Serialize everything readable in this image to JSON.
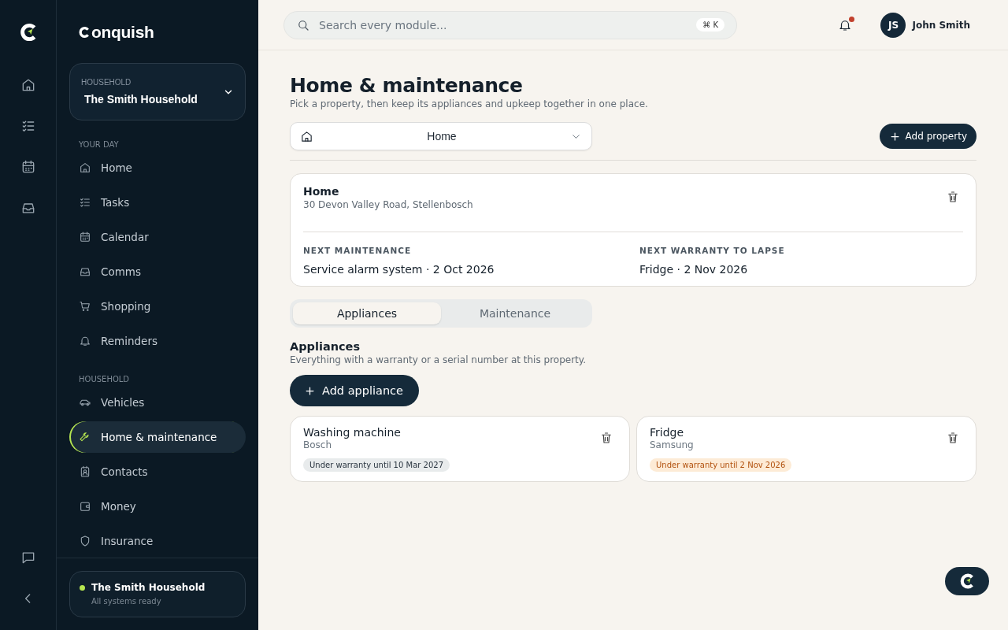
{
  "brand": {
    "wordmark": "onquish"
  },
  "sidebar": {
    "household_picker": {
      "label": "HOUSEHOLD",
      "value": "The Smith Household"
    },
    "sections": [
      {
        "heading": "YOUR DAY",
        "items": [
          {
            "label": "Home",
            "selected": false
          },
          {
            "label": "Tasks",
            "selected": false
          },
          {
            "label": "Calendar",
            "selected": false
          },
          {
            "label": "Comms",
            "selected": false
          },
          {
            "label": "Shopping",
            "selected": false
          },
          {
            "label": "Reminders",
            "selected": false
          }
        ]
      },
      {
        "heading": "HOUSEHOLD",
        "items": [
          {
            "label": "Vehicles",
            "selected": false
          },
          {
            "label": "Home & maintenance",
            "selected": true
          },
          {
            "label": "Contacts",
            "selected": false
          },
          {
            "label": "Money",
            "selected": false
          },
          {
            "label": "Insurance",
            "selected": false
          }
        ]
      }
    ],
    "status_card": {
      "title": "The Smith Household",
      "subtitle": "All systems ready",
      "online": true
    }
  },
  "topbar": {
    "search": {
      "placeholder": "Search every module...",
      "shortcut": "⌘ K"
    },
    "notifications": {
      "unread": true
    },
    "user": {
      "initials": "JS",
      "name": "John Smith"
    }
  },
  "page": {
    "title": "Home & maintenance",
    "subtitle": "Pick a property, then keep its appliances and upkeep together in one place.",
    "property_select": {
      "value": "Home"
    },
    "add_property": "Add property",
    "property_card": {
      "name": "Home",
      "address": "30 Devon Valley Road, Stellenbosch",
      "stats": [
        {
          "label": "NEXT MAINTENANCE",
          "value": "Service alarm system · 2 Oct 2026"
        },
        {
          "label": "NEXT WARRANTY TO LAPSE",
          "value": "Fridge · 2 Nov 2026"
        }
      ]
    },
    "tabs": [
      {
        "label": "Appliances",
        "selected": true
      },
      {
        "label": "Maintenance",
        "selected": false
      }
    ],
    "section": {
      "title": "Appliances",
      "subtitle": "Everything with a warranty or a serial number at this property.",
      "add_button": "Add appliance"
    },
    "appliances": [
      {
        "name": "Washing machine",
        "brand": "Bosch",
        "warranty": "Under warranty until 10 Mar 2027",
        "kind": "ok"
      },
      {
        "name": "Fridge",
        "brand": "Samsung",
        "warranty": "Under warranty until 2 Nov 2026",
        "kind": "expiring"
      }
    ]
  }
}
